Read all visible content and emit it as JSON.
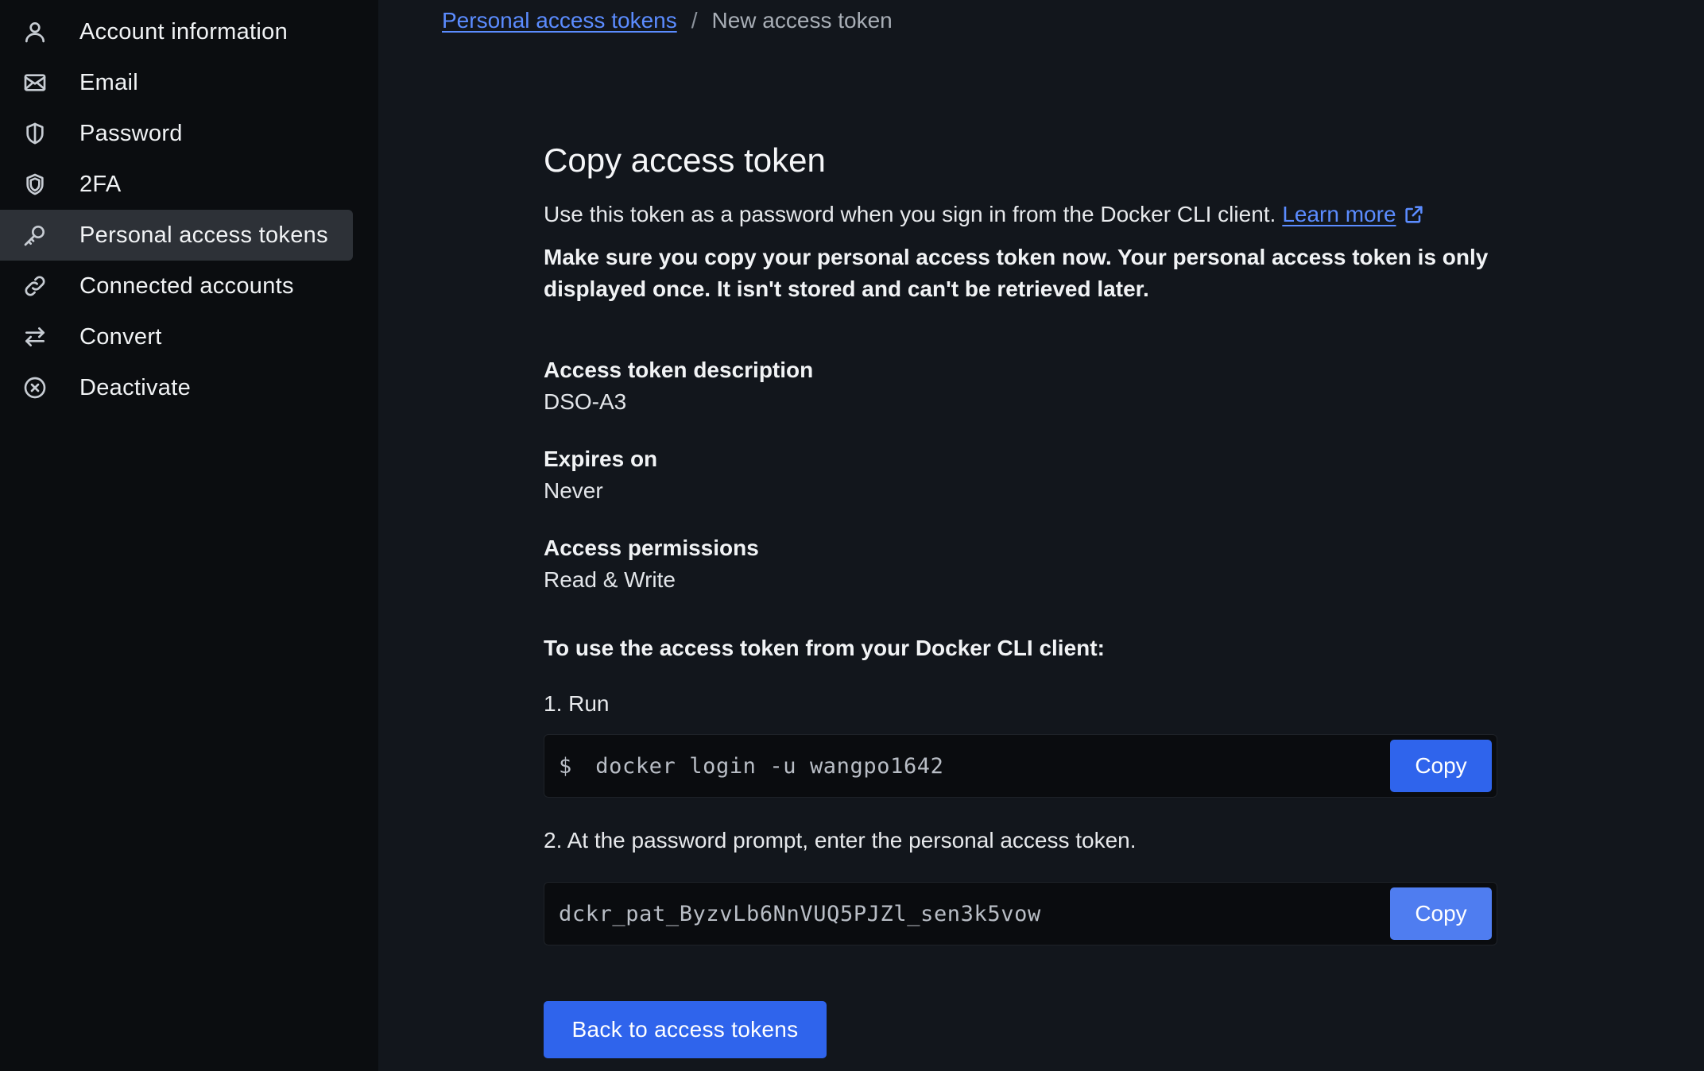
{
  "sidebar": {
    "items": [
      {
        "label": "Account information",
        "icon": "user-icon"
      },
      {
        "label": "Email",
        "icon": "mail-icon"
      },
      {
        "label": "Password",
        "icon": "shield-half-icon"
      },
      {
        "label": "2FA",
        "icon": "shield-icon"
      },
      {
        "label": "Personal access tokens",
        "icon": "key-icon",
        "active": true
      },
      {
        "label": "Connected accounts",
        "icon": "link-icon"
      },
      {
        "label": "Convert",
        "icon": "arrows-swap-icon"
      },
      {
        "label": "Deactivate",
        "icon": "close-circle-icon"
      }
    ]
  },
  "breadcrumb": {
    "parent": "Personal access tokens",
    "separator": "/",
    "current": "New access token"
  },
  "main": {
    "title": "Copy access token",
    "description": "Use this token as a password when you sign in from the Docker CLI client.",
    "learn_more": "Learn more",
    "warning": "Make sure you copy your personal access token now. Your personal access token is only displayed once. It isn't stored and can't be retrieved later.",
    "fields": [
      {
        "label": "Access token description",
        "value": "DSO-A3"
      },
      {
        "label": "Expires on",
        "value": "Never"
      },
      {
        "label": "Access permissions",
        "value": "Read & Write"
      }
    ],
    "instructions": "To use the access token from your Docker CLI client:",
    "step1": "1. Run",
    "command_prompt": "$",
    "command": "docker login -u wangpo1642",
    "step2": "2. At the password prompt, enter the personal access token.",
    "token": "dckr_pat_ByzvLb6NnVUQ5PJZl_sen3k5vow",
    "copy_label": "Copy",
    "back_label": "Back to access tokens"
  },
  "colors": {
    "accent": "#2f64ec",
    "link": "#5b8cff",
    "sidebar_bg": "#0b0d10",
    "page_bg": "#12161c"
  }
}
